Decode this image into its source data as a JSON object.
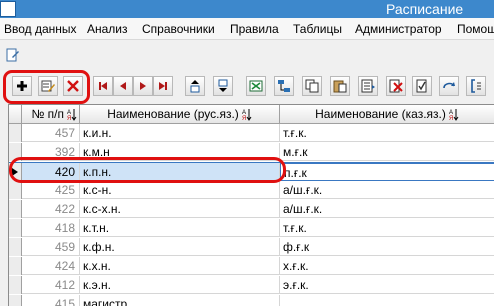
{
  "window": {
    "title": "Расписание"
  },
  "menu": [
    "Ввод данных",
    "Анализ",
    "Справочники",
    "Правила",
    "Таблицы",
    "Администратор",
    "Помощ"
  ],
  "toolbar": {
    "buttons": [
      {
        "name": "add-record-button",
        "icon": "plus-icon"
      },
      {
        "name": "edit-record-button",
        "icon": "edit-icon"
      },
      {
        "name": "delete-record-button",
        "icon": "delete-x-icon"
      },
      {
        "name": "first-record-button",
        "icon": "first-icon"
      },
      {
        "name": "prev-record-button",
        "icon": "prev-icon"
      },
      {
        "name": "next-record-button",
        "icon": "next-icon"
      },
      {
        "name": "last-record-button",
        "icon": "last-icon"
      },
      {
        "name": "move-up-button",
        "icon": "move-up-icon"
      },
      {
        "name": "move-down-button",
        "icon": "move-down-icon"
      },
      {
        "name": "export-excel-button",
        "icon": "excel-icon"
      },
      {
        "name": "network-button",
        "icon": "network-icon"
      },
      {
        "name": "copy-button",
        "icon": "copy-icon"
      },
      {
        "name": "paste-button",
        "icon": "paste-icon"
      },
      {
        "name": "list-button",
        "icon": "list-icon"
      },
      {
        "name": "clear-button",
        "icon": "clear-icon"
      },
      {
        "name": "check-button",
        "icon": "check-icon"
      },
      {
        "name": "refresh-button",
        "icon": "refresh-icon"
      },
      {
        "name": "settings-button",
        "icon": "bracket-icon"
      }
    ]
  },
  "grid": {
    "columns": [
      "№ п/п",
      "Наименование (рус.яз.)",
      "Наименование (каз.яз.)"
    ],
    "rows": [
      {
        "num": "457",
        "ru": "к.и.н.",
        "kz": "т.ғ.к."
      },
      {
        "num": "392",
        "ru": "к.м.н",
        "kz": "м.ғ.к"
      },
      {
        "num": "420",
        "ru": "к.п.н.",
        "kz": "п.ғ.к"
      },
      {
        "num": "425",
        "ru": "к.с-н.",
        "kz": "а/ш.ғ.к."
      },
      {
        "num": "422",
        "ru": "к.с-х.н.",
        "kz": "а/ш.ғ.к."
      },
      {
        "num": "418",
        "ru": "к.т.н.",
        "kz": "т.ғ.к."
      },
      {
        "num": "459",
        "ru": "к.ф.н.",
        "kz": "ф.ғ.к"
      },
      {
        "num": "424",
        "ru": "к.х.н.",
        "kz": "х.ғ.к."
      },
      {
        "num": "412",
        "ru": "к.э.н.",
        "kz": "э.ғ.к."
      },
      {
        "num": "415",
        "ru": "магистр",
        "kz": ""
      }
    ],
    "selected_index": 2
  },
  "colors": {
    "title_bar": "#3d88cc",
    "selection": "#cfe3f7",
    "annotation": "#e01010"
  }
}
